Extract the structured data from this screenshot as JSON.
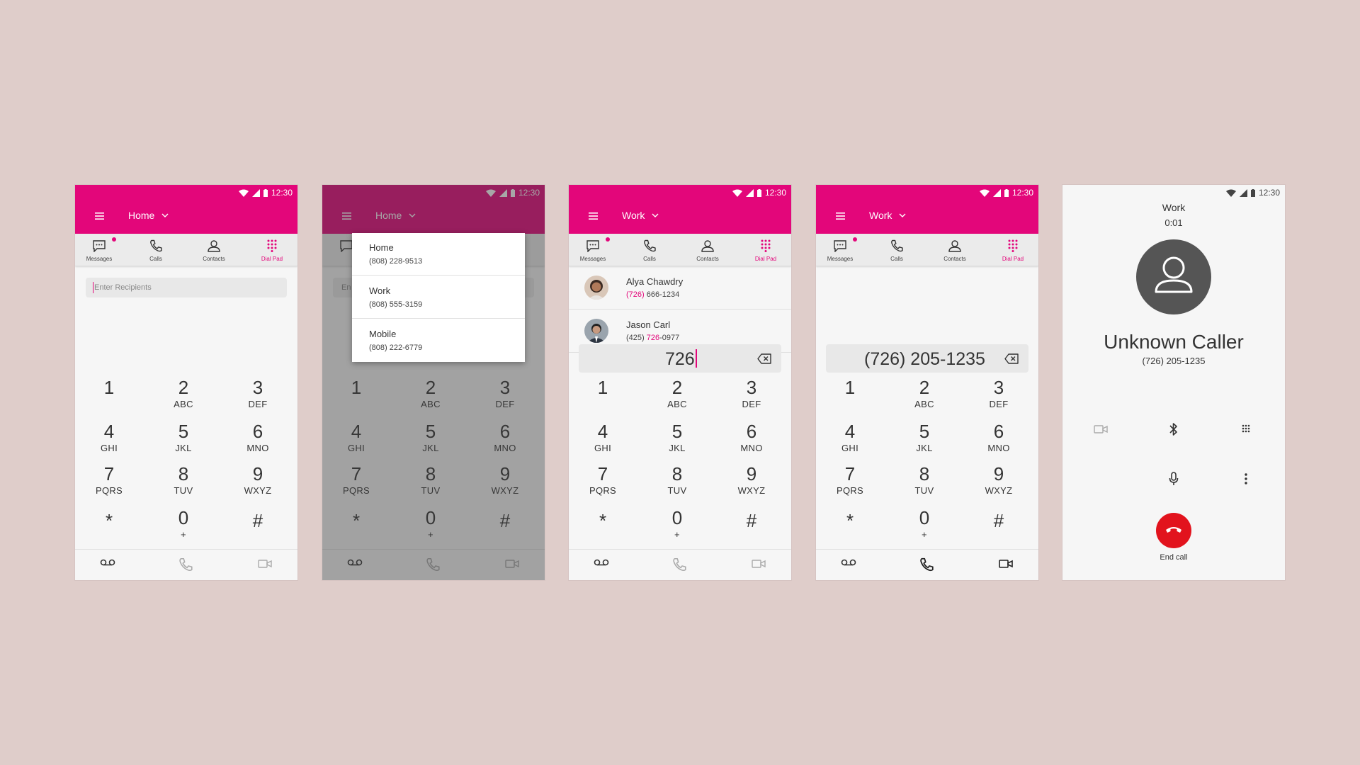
{
  "status": {
    "time": "12:30"
  },
  "tabs": [
    {
      "label": "Messages",
      "icon": "messages-icon"
    },
    {
      "label": "Calls",
      "icon": "phone-icon"
    },
    {
      "label": "Contacts",
      "icon": "contacts-icon"
    },
    {
      "label": "Dial Pad",
      "icon": "dialpad-icon"
    }
  ],
  "keys": [
    {
      "num": "1",
      "letters": ""
    },
    {
      "num": "2",
      "letters": "ABC"
    },
    {
      "num": "3",
      "letters": "DEF"
    },
    {
      "num": "4",
      "letters": "GHI"
    },
    {
      "num": "5",
      "letters": "JKL"
    },
    {
      "num": "6",
      "letters": "MNO"
    },
    {
      "num": "7",
      "letters": "PQRS"
    },
    {
      "num": "8",
      "letters": "TUV"
    },
    {
      "num": "9",
      "letters": "WXYZ"
    },
    {
      "num": "*",
      "letters": ""
    },
    {
      "num": "0",
      "letters": "+"
    },
    {
      "num": "#",
      "letters": ""
    }
  ],
  "colors": {
    "accent": "#e3067a",
    "end_call": "#e2131d"
  },
  "screen1": {
    "line_title": "Home",
    "recipients_placeholder": "Enter Recipients"
  },
  "screen2": {
    "line_title": "Home",
    "input_hint": "En",
    "lines": [
      {
        "name": "Home",
        "number": "(808) 228-9513"
      },
      {
        "name": "Work",
        "number": "(808) 555-3159"
      },
      {
        "name": "Mobile",
        "number": "(808) 222-6779"
      }
    ]
  },
  "screen3": {
    "line_title": "Work",
    "contacts": [
      {
        "name": "Alya Chawdry",
        "num_pre": "",
        "num_hl": "(726)",
        "num_post": " 666-1234"
      },
      {
        "name": "Jason Carl",
        "num_pre": "(425) ",
        "num_hl": "726",
        "num_post": "-0977"
      }
    ],
    "dialed": "726"
  },
  "screen4": {
    "line_title": "Work",
    "dialed": "(726) 205-1235"
  },
  "screen5": {
    "line": "Work",
    "duration": "0:01",
    "caller": "Unknown Caller",
    "number": "(726) 205-1235",
    "end_label": "End call"
  }
}
